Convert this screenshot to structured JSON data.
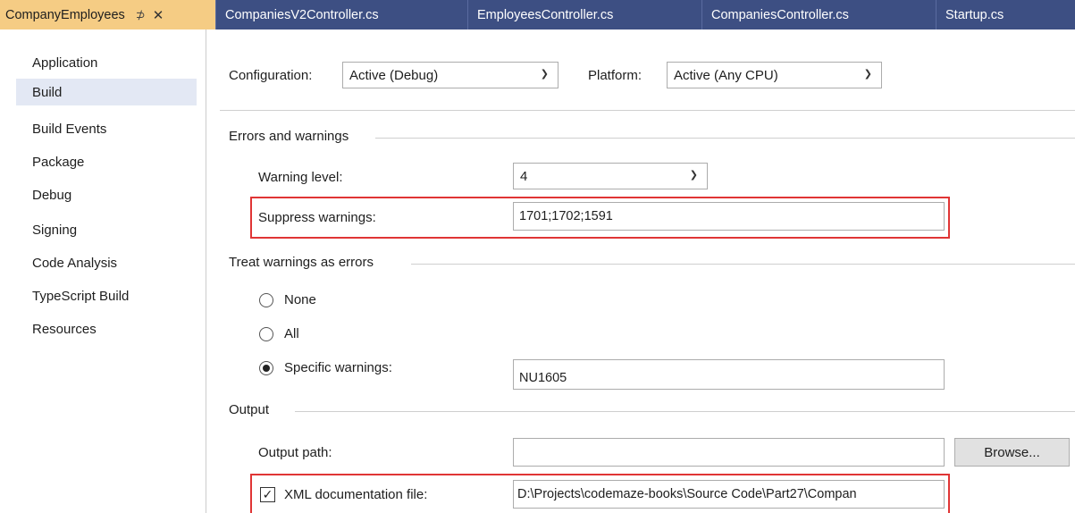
{
  "tabs": [
    {
      "label": "CompanyEmployees",
      "active": true
    },
    {
      "label": "CompaniesV2Controller.cs",
      "active": false
    },
    {
      "label": "EmployeesController.cs",
      "active": false
    },
    {
      "label": "CompaniesController.cs",
      "active": false
    },
    {
      "label": "Startup.cs",
      "active": false
    }
  ],
  "tab_pin_glyph": "⊅",
  "tab_close_glyph": "✕",
  "sidebar": {
    "items": [
      {
        "label": "Application"
      },
      {
        "label": "Build",
        "selected": true
      },
      {
        "label": "Build Events"
      },
      {
        "label": "Package"
      },
      {
        "label": "Debug"
      },
      {
        "label": "Signing"
      },
      {
        "label": "Code Analysis"
      },
      {
        "label": "TypeScript Build"
      },
      {
        "label": "Resources"
      }
    ]
  },
  "config": {
    "configuration_label": "Configuration:",
    "configuration_value": "Active (Debug)",
    "platform_label": "Platform:",
    "platform_value": "Active (Any CPU)"
  },
  "errors": {
    "section_title": "Errors and warnings",
    "warning_level_label": "Warning level:",
    "warning_level_value": "4",
    "suppress_label": "Suppress warnings:",
    "suppress_value": "1701;1702;1591"
  },
  "treat": {
    "section_title": "Treat warnings as errors",
    "none_label": "None",
    "all_label": "All",
    "specific_label": "Specific warnings:",
    "specific_value": "NU1605",
    "selected": "specific"
  },
  "output": {
    "section_title": "Output",
    "path_label": "Output path:",
    "path_value": "",
    "browse_label": "Browse...",
    "xml_label": "XML documentation file:",
    "xml_checked": true,
    "xml_value": "D:\\Projects\\codemaze-books\\Source Code\\Part27\\Compan"
  },
  "colors": {
    "tabbar": "#3d4f83",
    "active_tab": "#f5cc84",
    "sidebar_selected": "#e3e8f4",
    "highlight": "#e03535"
  }
}
